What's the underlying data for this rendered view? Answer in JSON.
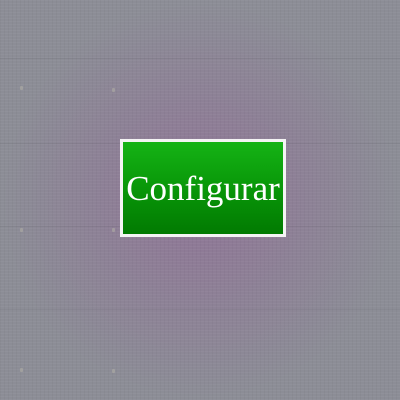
{
  "background": {
    "color": "#8c8d96"
  },
  "button": {
    "label": "Configurar",
    "color": "#0a9a0a",
    "border_color": "#f4f4f4",
    "text_color": "#ffffff"
  }
}
